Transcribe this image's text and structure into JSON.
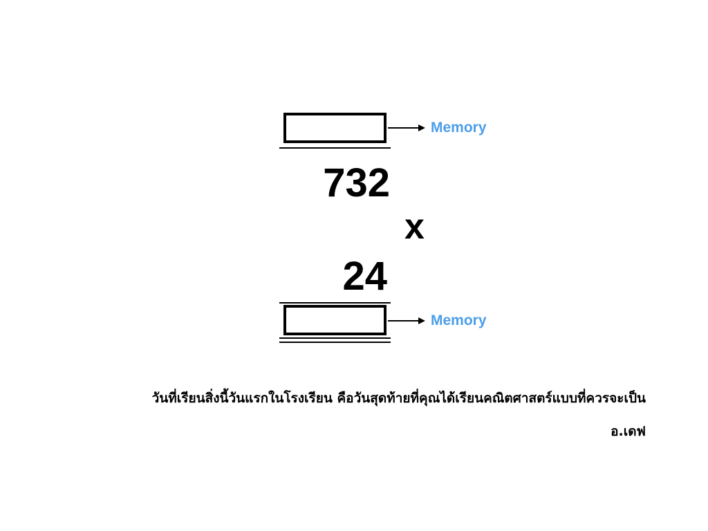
{
  "diagram": {
    "top_memory_label": "Memory",
    "bottom_memory_label": "Memory",
    "multiplicand": "732",
    "operator": "x",
    "multiplier": "24"
  },
  "quote": {
    "text": "วันที่เรียนสิ่งนี้วันแรกในโรงเรียน คือวันสุดท้ายที่คุณได้เรียนคณิตศาสตร์แบบที่ควรจะเป็น",
    "author": "อ.เดฟ"
  },
  "colors": {
    "memory_label": "#4a9eea",
    "ink": "#000000",
    "background": "#ffffff"
  }
}
